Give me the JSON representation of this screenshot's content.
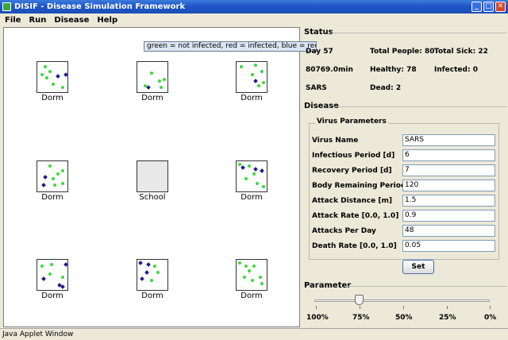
{
  "window": {
    "title": "DISIF - Disease Simulation Framework",
    "minimize": "_",
    "maximize": "□",
    "close": "✕"
  },
  "menu": [
    "File",
    "Run",
    "Disease",
    "Help"
  ],
  "tooltip": "green = not infected, red = infected, blue = recovered",
  "cells": [
    {
      "label": "Dorm"
    },
    {
      "label": "Dorm"
    },
    {
      "label": "Dorm"
    },
    {
      "label": "Dorm"
    },
    {
      "label": "School"
    },
    {
      "label": "Dorm"
    },
    {
      "label": "Dorm"
    },
    {
      "label": "Dorm"
    },
    {
      "label": "Dorm"
    }
  ],
  "status": {
    "title": "Status",
    "day": "Day 57",
    "total_people": "Total People: 80",
    "total_sick": "Total Sick: 22",
    "time": "80769.0min",
    "healthy": "Healthy: 78",
    "infected": "Infected: 0",
    "disease_name": "SARS",
    "dead": "Dead: 2"
  },
  "disease": {
    "title": "Disease",
    "group_title": "Virus Parameters",
    "params": [
      {
        "label": "Virus Name",
        "value": "SARS"
      },
      {
        "label": "Infectious Period [d]",
        "value": "6"
      },
      {
        "label": "Recovery Period [d]",
        "value": "7"
      },
      {
        "label": "Body Remaining Period [d]",
        "value": "120"
      },
      {
        "label": "Attack Distance [m]",
        "value": "1.5"
      },
      {
        "label": "Attack Rate [0.0, 1.0]",
        "value": "0.9"
      },
      {
        "label": "Attacks Per Day",
        "value": "48"
      },
      {
        "label": "Death Rate [0.0, 1.0]",
        "value": "0.05"
      }
    ],
    "set_label": "Set"
  },
  "parameter": {
    "title": "Parameter",
    "ticks": [
      "100%",
      "75%",
      "50%",
      "25%",
      "0%"
    ],
    "value_percent": 75
  },
  "statusbar": "Java Applet Window",
  "colors": {
    "healthy": "#3ad93a",
    "recovered": "#1c1c8c",
    "titlebar": "#1f56c9"
  }
}
